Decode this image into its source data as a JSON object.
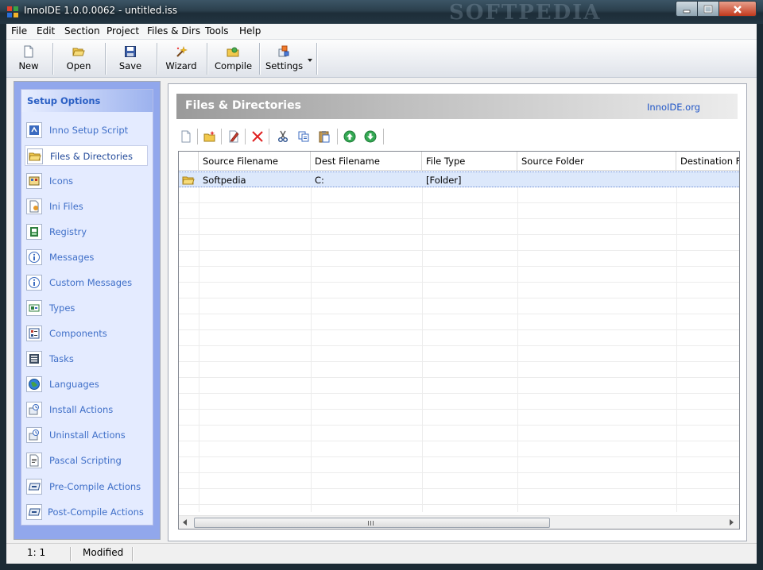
{
  "window": {
    "title": "InnoIDE 1.0.0.0062 - untitled.iss",
    "watermark": "SOFTPEDIA"
  },
  "menu": [
    {
      "id": "file",
      "label": "File"
    },
    {
      "id": "edit",
      "label": "Edit"
    },
    {
      "id": "section",
      "label": "Section"
    },
    {
      "id": "project",
      "label": "Project"
    },
    {
      "id": "files-dirs",
      "label": "Files & Dirs"
    },
    {
      "id": "tools",
      "label": "Tools"
    },
    {
      "id": "help",
      "label": "Help"
    }
  ],
  "toolbar": [
    {
      "id": "new",
      "label": "New",
      "icon": "new-document-icon"
    },
    {
      "id": "open",
      "label": "Open",
      "icon": "folder-open-icon"
    },
    {
      "id": "save",
      "label": "Save",
      "icon": "floppy-disk-icon"
    },
    {
      "id": "wizard",
      "label": "Wizard",
      "icon": "magic-wand-icon"
    },
    {
      "id": "compile",
      "label": "Compile",
      "icon": "compile-icon"
    },
    {
      "id": "settings",
      "label": "Settings",
      "icon": "settings-icon"
    }
  ],
  "sidebar": {
    "title": "Setup Options",
    "active_index": 1,
    "items": [
      {
        "label": "Inno Setup Script",
        "icon": "script-icon"
      },
      {
        "label": "Files & Directories",
        "icon": "folder-icon"
      },
      {
        "label": "Icons",
        "icon": "icons-icon"
      },
      {
        "label": "Ini Files",
        "icon": "ini-file-icon"
      },
      {
        "label": "Registry",
        "icon": "registry-icon"
      },
      {
        "label": "Messages",
        "icon": "info-icon"
      },
      {
        "label": "Custom Messages",
        "icon": "info-icon"
      },
      {
        "label": "Types",
        "icon": "types-icon"
      },
      {
        "label": "Components",
        "icon": "components-icon"
      },
      {
        "label": "Tasks",
        "icon": "tasks-icon"
      },
      {
        "label": "Languages",
        "icon": "globe-icon"
      },
      {
        "label": "Install Actions",
        "icon": "install-actions-icon"
      },
      {
        "label": "Uninstall Actions",
        "icon": "uninstall-actions-icon"
      },
      {
        "label": "Pascal Scripting",
        "icon": "pascal-script-icon"
      },
      {
        "label": "Pre-Compile Actions",
        "icon": "pre-compile-icon"
      },
      {
        "label": "Post-Compile Actions",
        "icon": "post-compile-icon"
      }
    ]
  },
  "panel": {
    "title": "Files & Directories",
    "link": "InnoIDE.org"
  },
  "files_toolbar": [
    "new-file-icon",
    "new-folder-icon",
    "edit-icon",
    "delete-icon",
    "cut-icon",
    "copy-icon",
    "paste-icon",
    "move-up-icon",
    "move-down-icon"
  ],
  "grid": {
    "columns": [
      "Source Filename",
      "Dest Filename",
      "File Type",
      "Source Folder",
      "Destination Folder"
    ],
    "rows": [
      {
        "icon": "folder-icon",
        "cells": [
          "Softpedia",
          "C:",
          "[Folder]",
          "",
          ""
        ]
      }
    ]
  },
  "status": {
    "position": "1:  1",
    "state": "Modified"
  },
  "colors": {
    "sidebar_frame": "#91a7ec",
    "sidebar_bg": "#e4ebff",
    "link_blue": "#3f6fc8",
    "selected_row": "#dce8fb"
  }
}
